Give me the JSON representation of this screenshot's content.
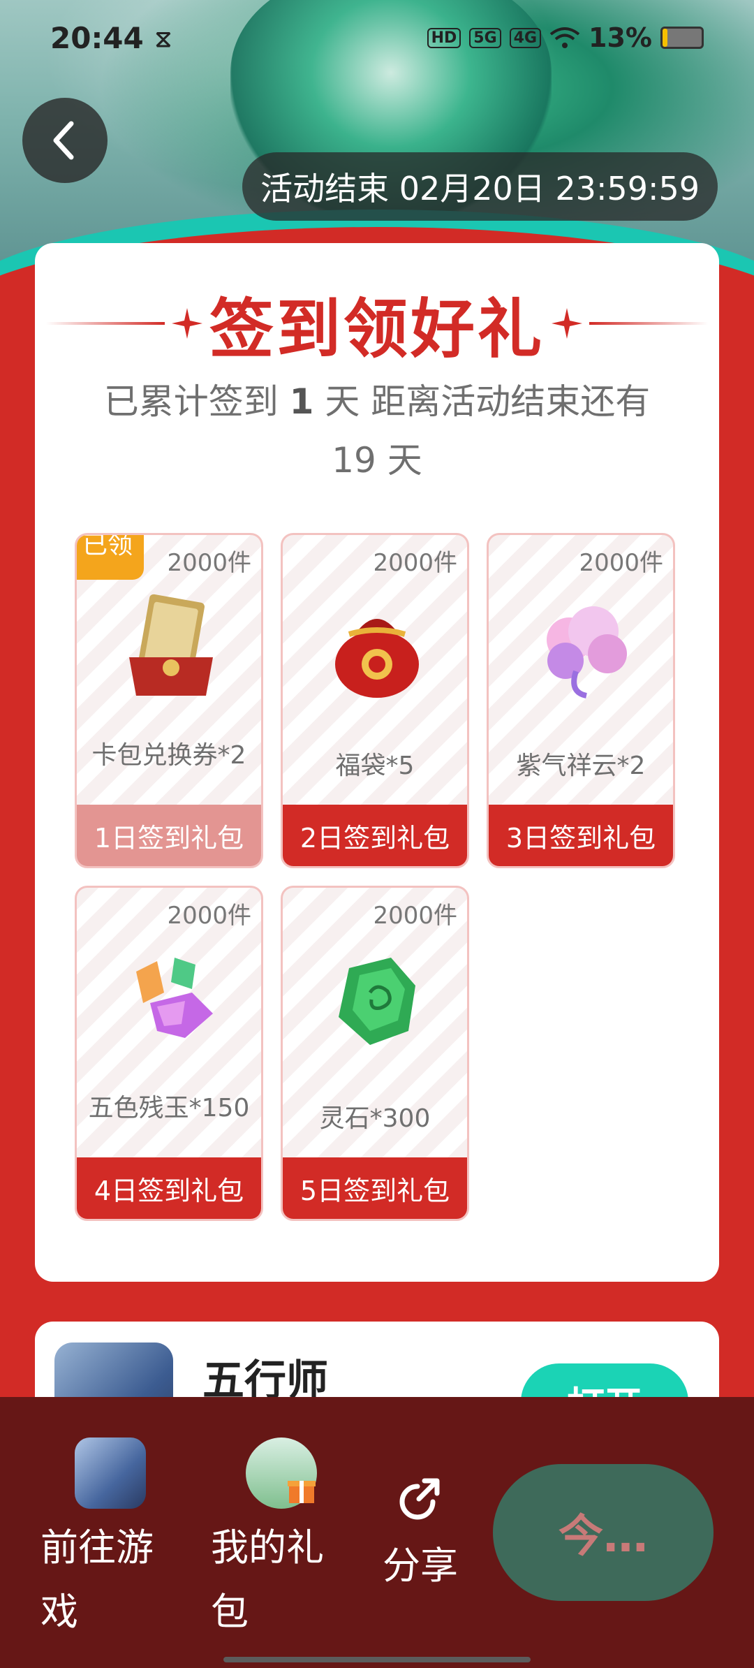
{
  "status_bar": {
    "time": "20:44",
    "hd_label": "HD",
    "net1": "5G",
    "net2": "4G",
    "battery": "13%",
    "battery_level": 0.13
  },
  "header": {
    "end_time": "活动结束 02月20日 23:59:59"
  },
  "checkin": {
    "title": "签到领好礼",
    "summary_prefix": "已累计签到 ",
    "days_signed": "1",
    "summary_mid": " 天  距离活动结束还有",
    "days_left_line": "19 天",
    "rewards": [
      {
        "qty": "2000件",
        "name": "卡包兑换券*2",
        "button": "1日签到礼包",
        "claimed_tag": "已领"
      },
      {
        "qty": "2000件",
        "name": "福袋*5",
        "button": "2日签到礼包"
      },
      {
        "qty": "2000件",
        "name": "紫气祥云*2",
        "button": "3日签到礼包"
      },
      {
        "qty": "2000件",
        "name": "五色残玉*150",
        "button": "4日签到礼包"
      },
      {
        "qty": "2000件",
        "name": "灵石*300",
        "button": "5日签到礼包"
      }
    ]
  },
  "app": {
    "name": "五行师",
    "open_button": "打开"
  },
  "bottom_bar": {
    "go_game": "前往游戏",
    "my_gifts": "我的礼包",
    "share": "分享",
    "cta": "今…"
  },
  "colors": {
    "brand_red": "#d22b26",
    "claimed_button": "#e39592",
    "bottom_bar": "#661716",
    "accent_teal": "#1bd3b5"
  }
}
